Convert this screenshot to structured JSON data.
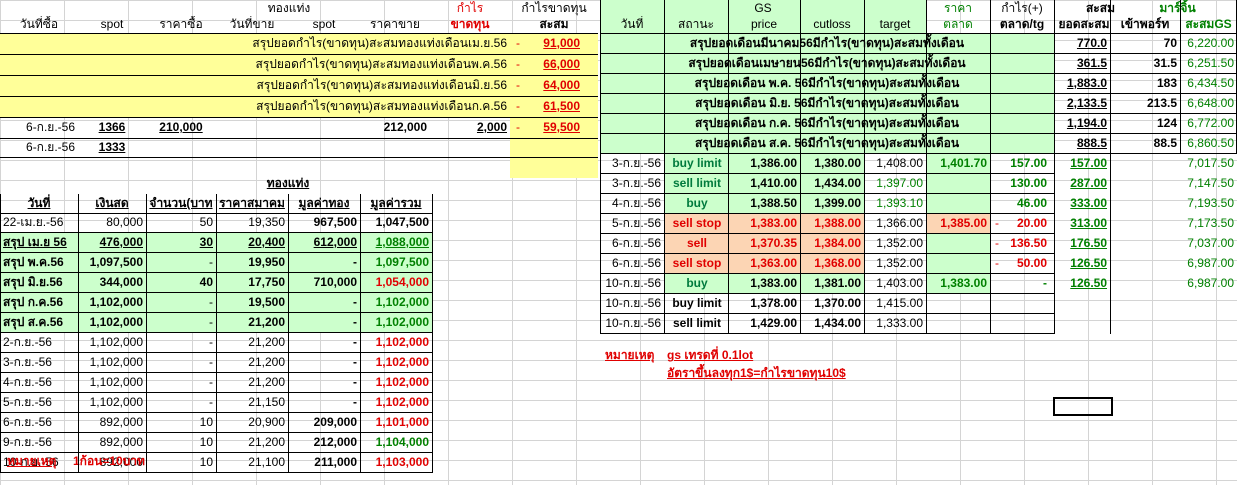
{
  "left_header": {
    "group_gold": "ทองแท่ง",
    "profit": "กำไร",
    "profit_loss_top": "กำไรขาดทุน",
    "buy_date": "วันที่ซื้อ",
    "spot1": "spot",
    "buy_price": "ราคาซื้อ",
    "sell_date": "วันที่ขาย",
    "spot2": "spot",
    "sell_price": "ราคาขาย",
    "loss": "ขาดทุน",
    "cumulative": "สะสม"
  },
  "summary_left": [
    {
      "label": "สรุปยอดกำไร(ขาดทุน)สะสมทองแท่งเดือนเม.ย.56",
      "sign": "-",
      "value": "91,000"
    },
    {
      "label": "สรุปยอดกำไร(ขาดทุน)สะสมทองแท่งเดือนพ.ค.56",
      "sign": "-",
      "value": "66,000"
    },
    {
      "label": "สรุปยอดกำไร(ขาดทุน)สะสมทองแท่งเดือนมิ.ย.56",
      "sign": "-",
      "value": "64,000"
    },
    {
      "label": "สรุปยอดกำไร(ขาดทุน)สะสมทองแท่งเดือนก.ค.56",
      "sign": "-",
      "value": "61,500"
    }
  ],
  "trade_rows": [
    {
      "date": "6-ก.ย.-56",
      "spot": "1366",
      "buy_price": "210,000",
      "sell_price": "212,000",
      "profit": "2,000",
      "sign": "-",
      "cum": "59,500"
    },
    {
      "date": "6-ก.ย.-56",
      "spot": "1333",
      "buy_price": "",
      "sell_price": "",
      "profit": "",
      "sign": "",
      "cum": ""
    }
  ],
  "gold_table": {
    "title": "ทองแท่ง",
    "headers": [
      "วันที่",
      "เงินสด",
      "จำนวน(บาท",
      "ราคาสมาคม",
      "มูลค่าทอง",
      "มูลค่ารวม"
    ],
    "rows": [
      {
        "date": "22-เม.ย.-56",
        "cash": "80,000",
        "qty": "50",
        "price": "19,350",
        "gold_value": "967,500",
        "total": "1,047,500",
        "style": "plain"
      },
      {
        "date": "สรุป เม.ย 56",
        "cash": "476,000",
        "qty": "30",
        "price": "20,400",
        "gold_value": "612,000",
        "total": "1,088,000",
        "style": "sum-u"
      },
      {
        "date": "สรุป พ.ค.56",
        "cash": "1,097,500",
        "qty": "-",
        "price": "19,950",
        "gold_value": "-",
        "total": "1,097,500",
        "style": "sum"
      },
      {
        "date": "สรุป มิ.ย.56",
        "cash": "344,000",
        "qty": "40",
        "price": "17,750",
        "gold_value": "710,000",
        "total": "1,054,000",
        "style": "sum-red"
      },
      {
        "date": "สรุป ก.ค.56",
        "cash": "1,102,000",
        "qty": "-",
        "price": "19,500",
        "gold_value": "-",
        "total": "1,102,000",
        "style": "sum"
      },
      {
        "date": "สรุป ส.ค.56",
        "cash": "1,102,000",
        "qty": "-",
        "price": "21,200",
        "gold_value": "-",
        "total": "1,102,000",
        "style": "sum"
      },
      {
        "date": "2-ก.ย.-56",
        "cash": "1,102,000",
        "qty": "-",
        "price": "21,200",
        "gold_value": "-",
        "total": "1,102,000",
        "style": "day"
      },
      {
        "date": "3-ก.ย.-56",
        "cash": "1,102,000",
        "qty": "-",
        "price": "21,200",
        "gold_value": "-",
        "total": "1,102,000",
        "style": "day"
      },
      {
        "date": "4-ก.ย.-56",
        "cash": "1,102,000",
        "qty": "-",
        "price": "21,200",
        "gold_value": "-",
        "total": "1,102,000",
        "style": "day"
      },
      {
        "date": "5-ก.ย.-56",
        "cash": "1,102,000",
        "qty": "-",
        "price": "21,150",
        "gold_value": "-",
        "total": "1,102,000",
        "style": "day"
      },
      {
        "date": "6-ก.ย.-56",
        "cash": "892,000",
        "qty": "10",
        "price": "20,900",
        "gold_value": "209,000",
        "total": "1,101,000",
        "style": "day"
      },
      {
        "date": "9-ก.ย.-56",
        "cash": "892,000",
        "qty": "10",
        "price": "21,200",
        "gold_value": "212,000",
        "total": "1,104,000",
        "style": "day-grn"
      },
      {
        "date": "10-ก.ย.-56",
        "cash": "892,000",
        "qty": "10",
        "price": "21,100",
        "gold_value": "211,000",
        "total": "1,103,000",
        "style": "day"
      }
    ],
    "note_label": "หมายเหตุ",
    "note_text": "1ก้อน=10บาท"
  },
  "right_header": {
    "gs": "GS",
    "price_top": "ราคา",
    "profit_plus": "กำไร(+)",
    "cum_top": "สะสม",
    "margin_top": "มาร์จิ้น",
    "date": "วันที่",
    "status": "สถานะ",
    "price": "price",
    "cutloss": "cutloss",
    "target": "target",
    "market": "ตลาด",
    "market_tg": "ตลาด/tg",
    "cum_total": "ยอดสะสม",
    "deposit": "เข้าพอร์ท",
    "cum_gs": "สะสมGS"
  },
  "summary_right": [
    {
      "label": "สรุปยอดเดือนมีนาคม56มีกำไร(ขาดทุน)สะสมทั้งเดือน",
      "total": "770.0",
      "deposit": "70",
      "gs": "6,220.00"
    },
    {
      "label": "สรุปยอดเดือนเมษายน56มีกำไร(ขาดทุน)สะสมทั้งเดือน",
      "total": "361.5",
      "deposit": "31.5",
      "gs": "6,251.50"
    },
    {
      "label": "สรุปยอดเดือน พ.ค. 56มีกำไร(ขาดทุน)สะสมทั้งเดือน",
      "total": "1,883.0",
      "deposit": "183",
      "gs": "6,434.50"
    },
    {
      "label": "สรุปยอดเดือน มิ.ย. 56มีกำไร(ขาดทุน)สะสมทั้งเดือน",
      "total": "2,133.5",
      "deposit": "213.5",
      "gs": "6,648.00"
    },
    {
      "label": "สรุปยอดเดือน ก.ค. 56มีกำไร(ขาดทุน)สะสมทั้งเดือน",
      "total": "1,194.0",
      "deposit": "124",
      "gs": "6,772.00"
    },
    {
      "label": "สรุปยอดเดือน ส.ค. 56มีกำไร(ขาดทุน)สะสมทั้งเดือน",
      "total": "888.5",
      "deposit": "88.5",
      "gs": "6,860.50"
    }
  ],
  "gs_rows": [
    {
      "date": "3-ก.ย.-56",
      "status": "buy limit",
      "price": "1,386.00",
      "cutloss": "1,380.00",
      "target": "1,408.00",
      "market": "1,401.70",
      "profit_sign": "",
      "profit": "157.00",
      "total": "157.00",
      "cum_gs": "7,017.50",
      "kind": "g"
    },
    {
      "date": "3-ก.ย.-56",
      "status": "sell limit",
      "price": "1,410.00",
      "cutloss": "1,434.00",
      "target": "1,397.00",
      "market": "",
      "profit_sign": "",
      "profit": "130.00",
      "total": "287.00",
      "cum_gs": "7,147.50",
      "kind": "g"
    },
    {
      "date": "4-ก.ย.-56",
      "status": "buy",
      "price": "1,388.50",
      "cutloss": "1,399.00",
      "target": "1,393.10",
      "market": "",
      "profit_sign": "",
      "profit": "46.00",
      "total": "333.00",
      "cum_gs": "7,193.50",
      "kind": "g"
    },
    {
      "date": "5-ก.ย.-56",
      "status": "sell stop",
      "price": "1,383.00",
      "cutloss": "1,388.00",
      "target": "1,366.00",
      "market": "1,385.00",
      "profit_sign": "-",
      "profit": "20.00",
      "total": "313.00",
      "cum_gs": "7,173.50",
      "kind": "o"
    },
    {
      "date": "6-ก.ย.-56",
      "status": "sell",
      "price": "1,370.35",
      "cutloss": "1,384.00",
      "target": "1,352.00",
      "market": "",
      "profit_sign": "-",
      "profit": "136.50",
      "total": "176.50",
      "cum_gs": "7,037.00",
      "kind": "o"
    },
    {
      "date": "6-ก.ย.-56",
      "status": "sell stop",
      "price": "1,363.00",
      "cutloss": "1,368.00",
      "target": "1,352.00",
      "market": "",
      "profit_sign": "-",
      "profit": "50.00",
      "total": "126.50",
      "cum_gs": "6,987.00",
      "kind": "o"
    },
    {
      "date": "10-ก.ย.-56",
      "status": "buy",
      "price": "1,383.00",
      "cutloss": "1,381.00",
      "target": "1,403.00",
      "market": "1,383.00",
      "profit_sign": "",
      "profit": "-",
      "total": "126.50",
      "cum_gs": "6,987.00",
      "kind": "g"
    },
    {
      "date": "10-ก.ย.-56",
      "status": "buy limit",
      "price": "1,378.00",
      "cutloss": "1,370.00",
      "target": "1,415.00",
      "market": "",
      "profit_sign": "",
      "profit": "",
      "total": "",
      "cum_gs": "",
      "kind": "n"
    },
    {
      "date": "10-ก.ย.-56",
      "status": "sell limit",
      "price": "1,429.00",
      "cutloss": "1,434.00",
      "target": "1,333.00",
      "market": "",
      "profit_sign": "",
      "profit": "",
      "total": "",
      "cum_gs": "",
      "kind": "n"
    }
  ],
  "right_note": {
    "label": "หมายเหตุ",
    "text1": "gs เทรดที่ 0.1lot",
    "text2": "อัตราขึ้นลงทุก1$=กำไรขาดทุน10$"
  }
}
